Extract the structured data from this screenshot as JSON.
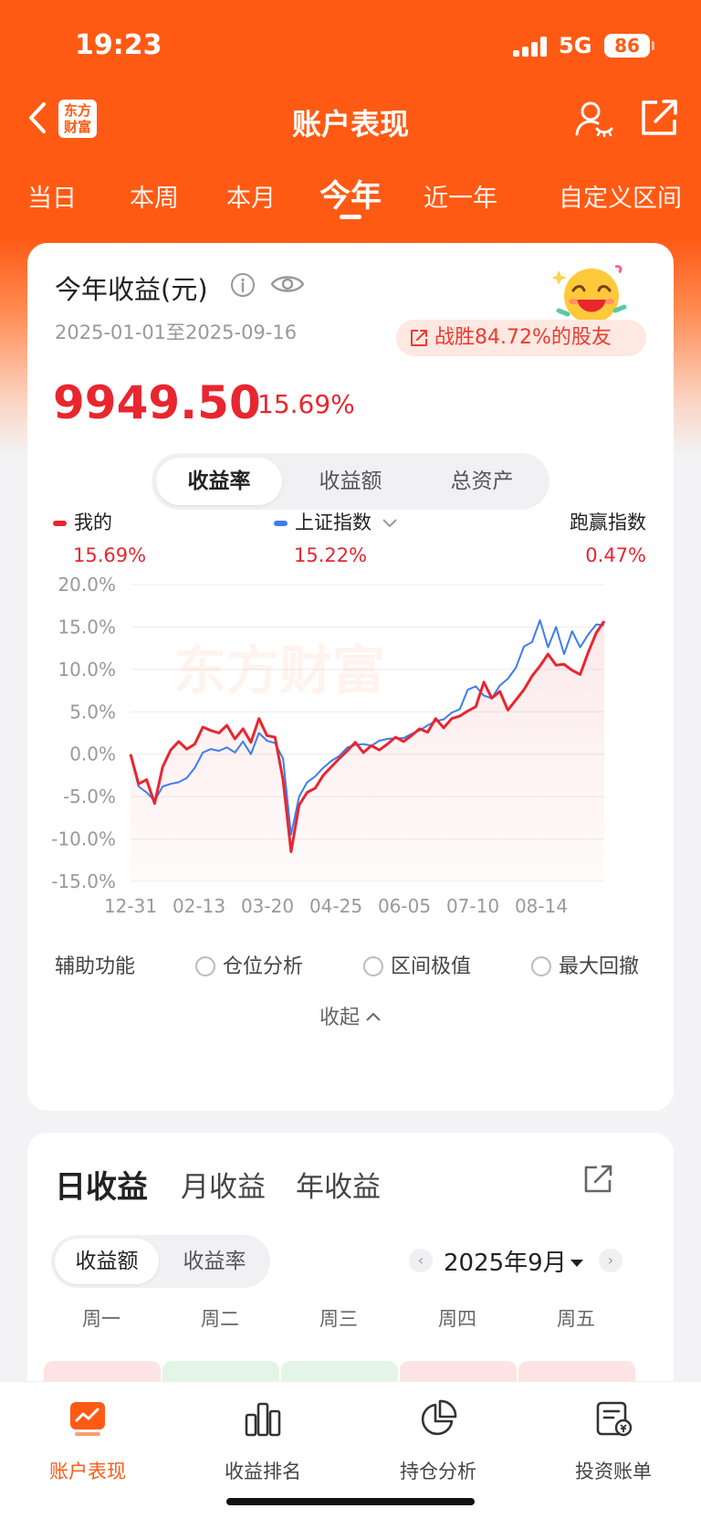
{
  "status_bar": {
    "time": "19:23",
    "network": "5G",
    "battery": "86"
  },
  "nav": {
    "title": "账户表现",
    "logo_top": "东方",
    "logo_bottom": "财富"
  },
  "period_tabs": [
    "当日",
    "本周",
    "本月",
    "今年",
    "近一年",
    "自定义区间"
  ],
  "active_period": "今年",
  "summary": {
    "title": "今年收益(元)",
    "date_range": "2025-01-01至2025-09-16",
    "beat_text": "战胜84.72%的股友",
    "amount": "9949.50",
    "rate": "15.69%"
  },
  "chart_tabs": [
    "收益率",
    "收益额",
    "总资产"
  ],
  "active_chart_tab": "收益率",
  "legend": {
    "mine_label": "我的",
    "mine_value": "15.69%",
    "index_label": "上证指数",
    "index_value": "15.22%",
    "excess_label": "跑赢指数",
    "excess_value": "0.47%"
  },
  "watermark": "东方财富",
  "chart_data": {
    "type": "line",
    "x_ticks": [
      "12-31",
      "02-13",
      "03-20",
      "04-25",
      "06-05",
      "07-10",
      "08-14"
    ],
    "y_ticks": [
      "20.0%",
      "15.0%",
      "10.0%",
      "5.0%",
      "0.0%",
      "-5.0%",
      "-10.0%",
      "-15.0%"
    ],
    "ylim": [
      -15,
      20
    ],
    "series": [
      {
        "name": "我的",
        "color": "#e8262f",
        "values": [
          0,
          -3.5,
          -3,
          -5.8,
          -1.5,
          0.5,
          1.5,
          0.6,
          1.2,
          3.2,
          2.8,
          2.5,
          3.4,
          1.8,
          3.0,
          1.4,
          4.2,
          2.2,
          2.0,
          -3.0,
          -11.5,
          -6.0,
          -4.5,
          -4.0,
          -2.5,
          -1.5,
          -0.5,
          0.4,
          1.4,
          0.2,
          1.0,
          0.5,
          1.2,
          2.0,
          1.5,
          2.2,
          3.0,
          2.6,
          4.2,
          3.1,
          4.2,
          4.5,
          5.1,
          5.6,
          8.5,
          6.6,
          7.4,
          5.2,
          6.4,
          7.6,
          9.2,
          10.4,
          11.8,
          10.5,
          10.6,
          9.9,
          9.4,
          12.0,
          14.3,
          15.69
        ]
      },
      {
        "name": "上证指数",
        "color": "#3d7df0",
        "values": [
          0,
          -3.8,
          -4.5,
          -5.5,
          -3.8,
          -3.5,
          -3.3,
          -2.8,
          -1.6,
          0.2,
          0.6,
          0.4,
          0.8,
          0.2,
          1.5,
          0.0,
          2.5,
          1.6,
          1.3,
          -0.5,
          -9.5,
          -5.0,
          -3.3,
          -2.6,
          -1.6,
          -0.8,
          -0.2,
          0.8,
          1.1,
          1.2,
          1.0,
          1.6,
          1.8,
          1.9,
          1.9,
          2.4,
          2.8,
          3.4,
          3.9,
          4.1,
          4.9,
          5.3,
          7.6,
          8.0,
          6.9,
          6.6,
          8.1,
          8.9,
          10.2,
          12.7,
          13.2,
          15.8,
          12.6,
          15.0,
          11.8,
          14.5,
          12.6,
          14.1,
          15.3,
          15.22
        ]
      }
    ]
  },
  "aux": {
    "label": "辅助功能",
    "options": [
      "仓位分析",
      "区间极值",
      "最大回撤"
    ],
    "collapse": "收起"
  },
  "returns": {
    "tabs": [
      "日收益",
      "月收益",
      "年收益"
    ],
    "active_tab": "日收益",
    "metric_tabs": [
      "收益额",
      "收益率"
    ],
    "active_metric": "收益额",
    "month": "2025年9月",
    "weekdays": [
      "周一",
      "周二",
      "周三",
      "周四",
      "周五"
    ],
    "day_colors": [
      "#fde3e3",
      "#e3f5e7",
      "#e3f5e7",
      "#fde3e3",
      "#fde3e3"
    ]
  },
  "bottom_nav": [
    "账户表现",
    "收益排名",
    "持仓分析",
    "投资账单"
  ],
  "colors": {
    "brand": "#ff5a14",
    "up": "#e8262f",
    "index": "#3d7df0"
  }
}
